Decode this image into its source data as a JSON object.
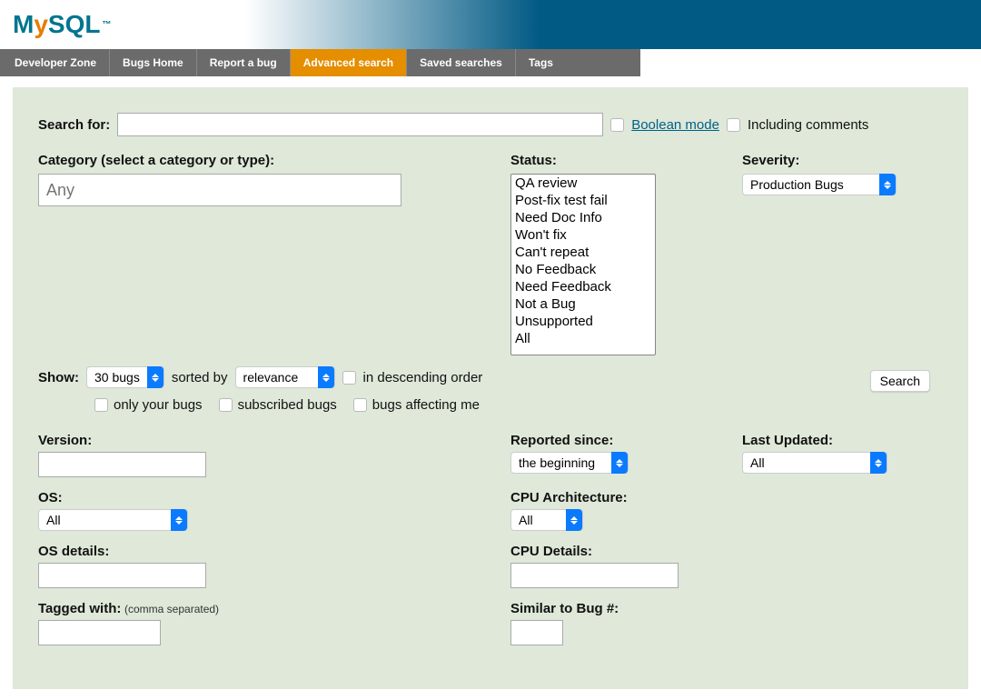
{
  "logo": {
    "text": "MySQL"
  },
  "nav": [
    {
      "label": "Developer Zone"
    },
    {
      "label": "Bugs Home"
    },
    {
      "label": "Report a bug"
    },
    {
      "label": "Advanced search",
      "active": true
    },
    {
      "label": "Saved searches"
    },
    {
      "label": "Tags"
    }
  ],
  "search": {
    "label": "Search for:",
    "value": "",
    "boolean_mode": "Boolean mode",
    "including_comments": "Including comments"
  },
  "category": {
    "label": "Category (select a category or type):",
    "placeholder": "Any"
  },
  "status": {
    "label": "Status:",
    "options": [
      "QA review",
      "Post-fix test fail",
      "Need Doc Info",
      "Won't fix",
      "Can't repeat",
      "No Feedback",
      "Need Feedback",
      "Not a Bug",
      "Unsupported",
      "All"
    ]
  },
  "severity": {
    "label": "Severity:",
    "selected": "Production Bugs"
  },
  "show": {
    "label": "Show:",
    "count": "30 bugs",
    "sorted_by_label": "sorted by",
    "sort_field": "relevance",
    "descending": "in descending order"
  },
  "filters": {
    "only_your": "only your bugs",
    "subscribed": "subscribed bugs",
    "affecting": "bugs affecting me"
  },
  "search_button": "Search",
  "version": {
    "label": "Version:"
  },
  "reported_since": {
    "label": "Reported since:",
    "selected": "the beginning"
  },
  "last_updated": {
    "label": "Last Updated:",
    "selected": "All"
  },
  "os": {
    "label": "OS:",
    "selected": "All"
  },
  "cpu_arch": {
    "label": "CPU Architecture:",
    "selected": "All"
  },
  "os_details": {
    "label": "OS details:"
  },
  "cpu_details": {
    "label": "CPU Details:"
  },
  "tagged": {
    "label": "Tagged with:",
    "hint": "(comma separated)"
  },
  "similar": {
    "label": "Similar to Bug #:"
  }
}
